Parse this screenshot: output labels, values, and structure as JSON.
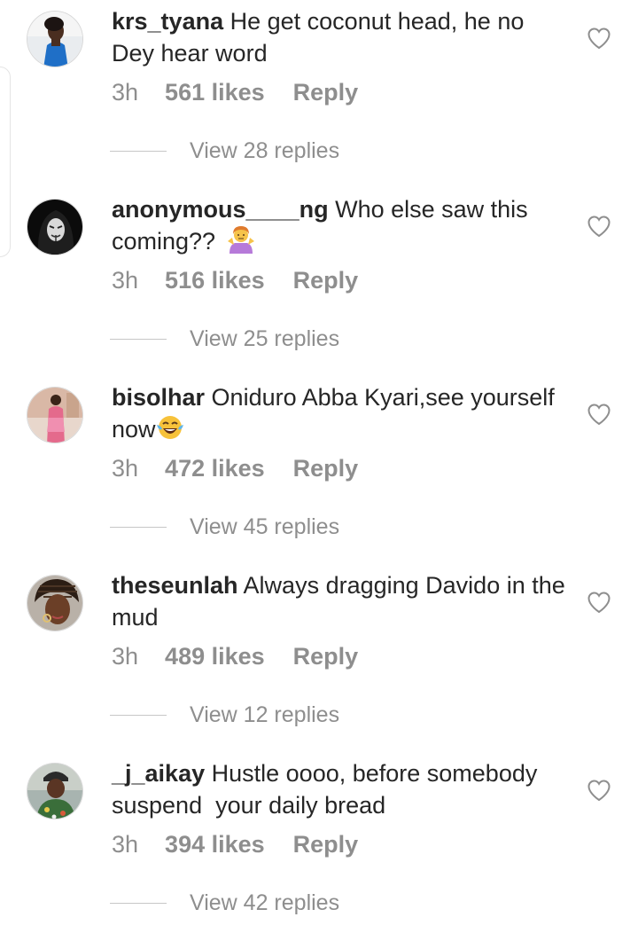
{
  "comments": [
    {
      "username": "krs_tyana",
      "text": "He get coconut head, he no Dey hear word",
      "time": "3h",
      "likes": "561 likes",
      "reply": "Reply",
      "view_replies": "View 28 replies",
      "emoji": "",
      "avatar": "profile-photo-woman-blue-dress"
    },
    {
      "username": "anonymous____ng",
      "text": "Who else saw this coming??",
      "time": "3h",
      "likes": "516 likes",
      "reply": "Reply",
      "view_replies": "View 25 replies",
      "emoji": "person-shrugging-emoji",
      "avatar": "profile-photo-anonymous-mask"
    },
    {
      "username": "bisolhar",
      "text": "Oniduro Abba Kyari,see yourself now",
      "time": "3h",
      "likes": "472 likes",
      "reply": "Reply",
      "view_replies": "View 45 replies",
      "emoji": "face-with-tears-of-joy-emoji",
      "avatar": "profile-photo-woman-standing"
    },
    {
      "username": "theseunlah",
      "text": "Always dragging Davido in the mud",
      "time": "3h",
      "likes": "489 likes",
      "reply": "Reply",
      "view_replies": "View 12 replies",
      "emoji": "",
      "avatar": "profile-photo-braids"
    },
    {
      "username": "_j_aikay",
      "text": "Hustle oooo, before somebody suspend  your daily bread",
      "time": "3h",
      "likes": "394 likes",
      "reply": "Reply",
      "view_replies": "View 42 replies",
      "emoji": "",
      "avatar": "profile-photo-man-cap"
    }
  ],
  "icons": {
    "like": "heart-outline-icon"
  },
  "colors": {
    "text": "#262626",
    "secondary": "#8e8e8e",
    "divider": "#c7c7c7",
    "background": "#ffffff"
  }
}
